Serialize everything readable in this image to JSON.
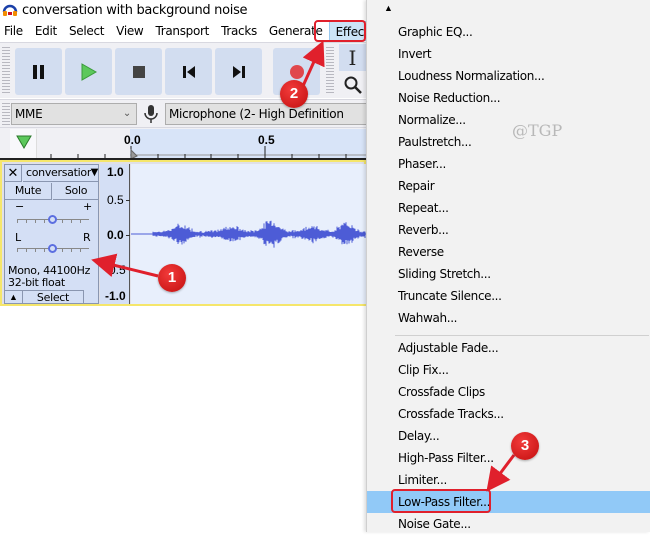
{
  "window": {
    "title": "conversation with background noise"
  },
  "menubar": {
    "items": [
      {
        "label": "File"
      },
      {
        "label": "Edit"
      },
      {
        "label": "Select"
      },
      {
        "label": "View"
      },
      {
        "label": "Transport"
      },
      {
        "label": "Tracks"
      },
      {
        "label": "Generate"
      },
      {
        "label": "Effect"
      }
    ],
    "active": "Effect"
  },
  "transport": {
    "buttons": [
      "pause-icon",
      "play-icon",
      "stop-icon",
      "skip-to-start-icon",
      "skip-to-end-icon",
      "record-icon"
    ]
  },
  "tools": [
    "selection-tool-icon",
    "zoom-icon"
  ],
  "device": {
    "host": "MME",
    "input": "Microphone (2- High Definition"
  },
  "ruler": {
    "ticks": [
      "0.0",
      "0.5"
    ]
  },
  "track": {
    "name": "conversation",
    "mute_label": "Mute",
    "solo_label": "Solo",
    "gain_minus": "−",
    "gain_plus": "+",
    "pan_left": "L",
    "pan_right": "R",
    "info_line1": "Mono, 44100Hz",
    "info_line2": "32-bit float",
    "select_label": "Select",
    "scale": [
      "1.0",
      "0.5",
      "0.0",
      "-0.5",
      "-1.0"
    ]
  },
  "effect_menu": {
    "scroll_up": "▲",
    "group1": [
      "Graphic EQ...",
      "Invert",
      "Loudness Normalization...",
      "Noise Reduction...",
      "Normalize...",
      "Paulstretch...",
      "Phaser...",
      "Repair",
      "Repeat...",
      "Reverb...",
      "Reverse",
      "Sliding Stretch...",
      "Truncate Silence...",
      "Wahwah..."
    ],
    "group2": [
      "Adjustable Fade...",
      "Clip Fix...",
      "Crossfade Clips",
      "Crossfade Tracks...",
      "Delay...",
      "High-Pass Filter...",
      "Limiter...",
      "Low-Pass Filter...",
      "Noise Gate..."
    ],
    "highlighted": "Low-Pass Filter..."
  },
  "annotations": {
    "step1": "1",
    "step2": "2",
    "step3": "3"
  },
  "watermark": "@TGP",
  "colors": {
    "accent": "#e0202c",
    "highlight": "#91c9f7",
    "waveform": "#4d5cd6"
  }
}
